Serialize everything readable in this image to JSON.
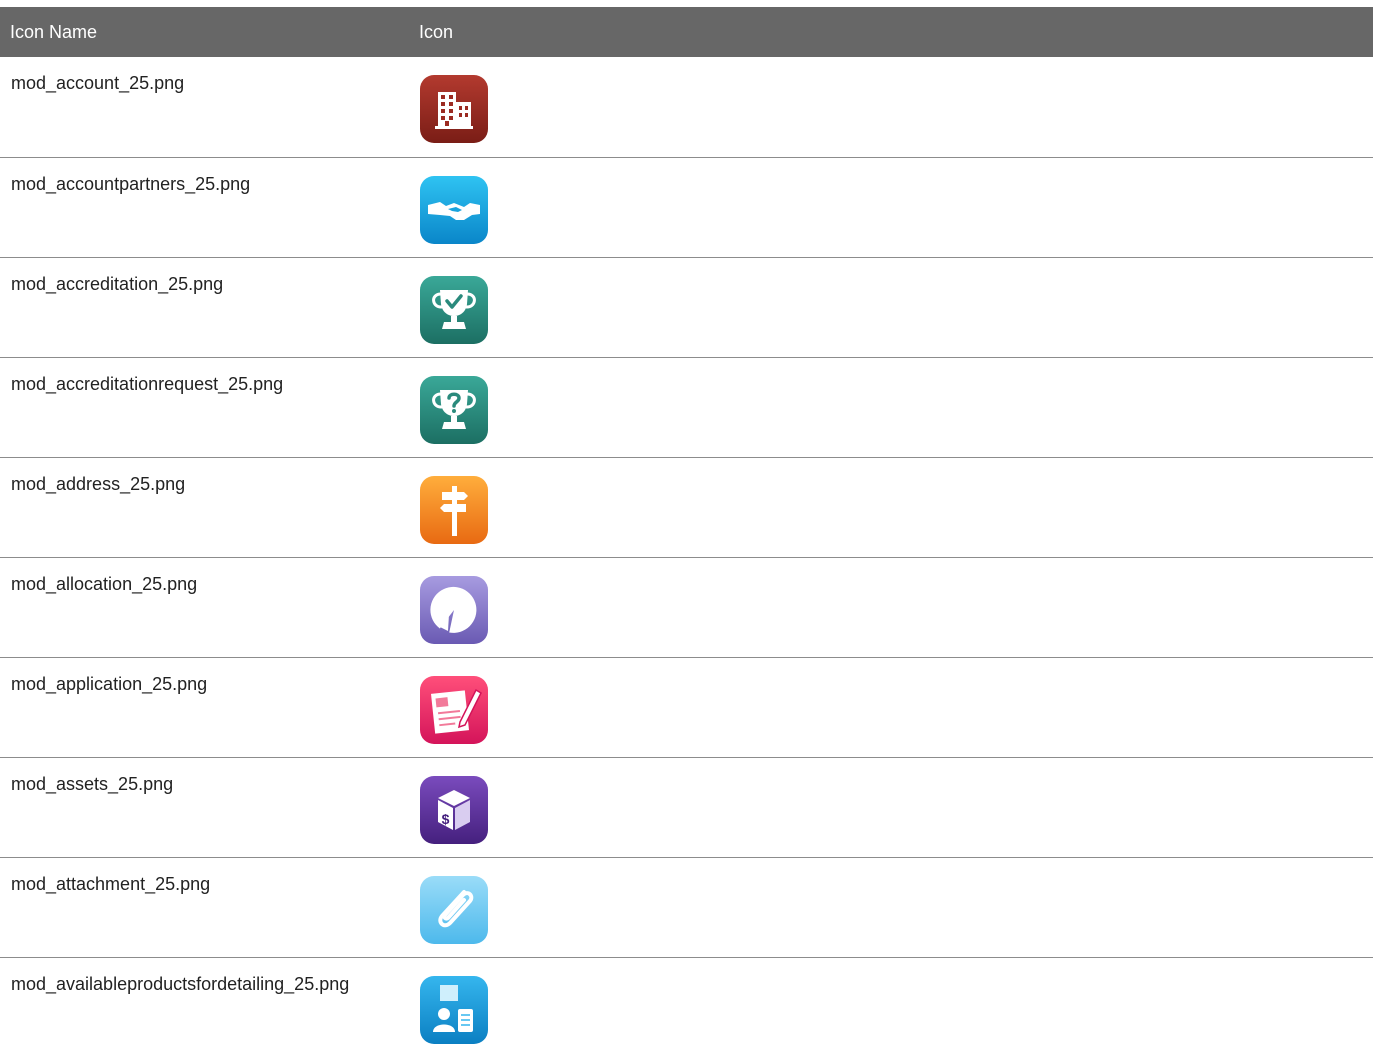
{
  "table": {
    "headers": {
      "name": "Icon Name",
      "icon": "Icon"
    },
    "rows": [
      {
        "name": "mod_account_25.png",
        "icon": "building-icon",
        "colors": [
          "#b33a2f",
          "#7a1d16"
        ]
      },
      {
        "name": "mod_accountpartners_25.png",
        "icon": "handshake-icon",
        "colors": [
          "#2fc3f2",
          "#0a86c9"
        ]
      },
      {
        "name": "mod_accreditation_25.png",
        "icon": "trophy-check-icon",
        "colors": [
          "#3aa898",
          "#1c6f63"
        ]
      },
      {
        "name": "mod_accreditationrequest_25.png",
        "icon": "trophy-question-icon",
        "colors": [
          "#3aa898",
          "#1c6f63"
        ]
      },
      {
        "name": "mod_address_25.png",
        "icon": "signpost-icon",
        "colors": [
          "#ffae3c",
          "#e86a12"
        ]
      },
      {
        "name": "mod_allocation_25.png",
        "icon": "pie-chart-icon",
        "colors": [
          "#a79be0",
          "#6a5ab3"
        ]
      },
      {
        "name": "mod_application_25.png",
        "icon": "application-form-icon",
        "colors": [
          "#ff4f7a",
          "#d4145a"
        ]
      },
      {
        "name": "mod_assets_25.png",
        "icon": "asset-box-icon",
        "colors": [
          "#7a4bbd",
          "#45207e"
        ]
      },
      {
        "name": "mod_attachment_25.png",
        "icon": "paperclip-icon",
        "colors": [
          "#9adcf8",
          "#4db9ec"
        ]
      },
      {
        "name": "mod_availableproductsfordetailing_25.png",
        "icon": "product-detail-icon",
        "colors": [
          "#35b6ee",
          "#0b7fc2"
        ]
      }
    ]
  }
}
